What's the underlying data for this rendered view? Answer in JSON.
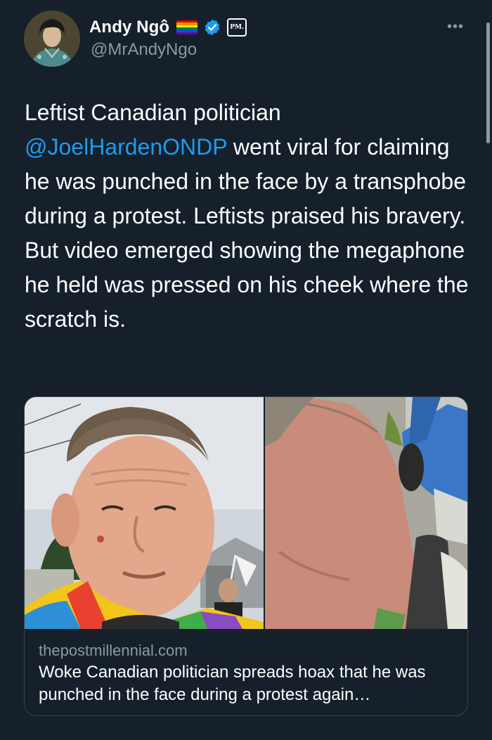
{
  "author": {
    "display_name": "Andy Ngô",
    "handle": "@MrAndyNgo",
    "flag_icon": "rainbow-flag-icon",
    "verified_icon": "verified-badge-icon",
    "affiliation_badge": "PM."
  },
  "menu": {
    "more_label": "•••"
  },
  "tweet": {
    "text_before_mention": "Leftist Canadian politician ",
    "mention": "@JoelHardenONDP",
    "text_after_mention": " went viral for claiming he was punched in the face by a transphobe during a protest. Leftists praised his bravery. But video emerged showing the megaphone he held was pressed on his cheek where the scratch is."
  },
  "link_card": {
    "domain": "thepostmillennial.com",
    "headline": "Woke Canadian politician spreads hoax that he was punched in the face during a protest again…"
  },
  "colors": {
    "background": "#15202b",
    "text": "#ffffff",
    "secondary_text": "#8b98a5",
    "link": "#1d9bf0",
    "verified": "#1d9bf0",
    "border": "#38444d"
  }
}
